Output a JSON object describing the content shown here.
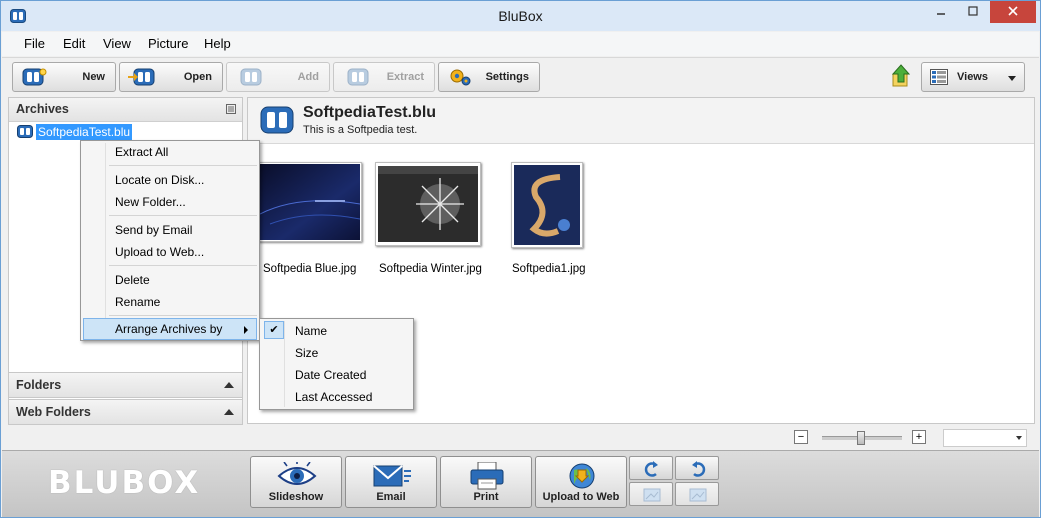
{
  "window": {
    "title": "BluBox"
  },
  "menubar": {
    "items": [
      "File",
      "Edit",
      "View",
      "Picture",
      "Help"
    ]
  },
  "toolbar": {
    "new_label": "New",
    "open_label": "Open",
    "add_label": "Add",
    "extract_label": "Extract",
    "settings_label": "Settings",
    "views_label": "Views"
  },
  "left_panel": {
    "archives_header": "Archives",
    "archive_item": "SoftpediaTest.blu",
    "folders_header": "Folders",
    "web_folders_header": "Web Folders"
  },
  "content": {
    "archive_name": "SoftpediaTest.blu",
    "archive_description": "This is a Softpedia test.",
    "thumbnails": [
      {
        "caption": "Softpedia Blue.jpg"
      },
      {
        "caption": "Softpedia Winter.jpg"
      },
      {
        "caption": "Softpedia1.jpg"
      }
    ]
  },
  "context_menu": {
    "extract_all": "Extract All",
    "locate_on_disk": "Locate on Disk...",
    "new_folder": "New Folder...",
    "send_by_email": "Send by Email",
    "upload_to_web": "Upload to Web...",
    "delete": "Delete",
    "rename": "Rename",
    "arrange_archives_by": "Arrange Archives by"
  },
  "submenu": {
    "name": "Name",
    "size": "Size",
    "date_created": "Date Created",
    "last_accessed": "Last Accessed",
    "checked": "Name"
  },
  "bottombar": {
    "logo": "BLUBOX",
    "slideshow_label": "Slideshow",
    "email_label": "Email",
    "print_label": "Print",
    "upload_label": "Upload to Web"
  },
  "zoom": {
    "minus": "−",
    "plus": "+"
  },
  "colors": {
    "selection": "#3399ff",
    "menu_highlight": "#cde4f7",
    "brand_blue": "#2b6cb8",
    "close_red": "#c7453c"
  }
}
